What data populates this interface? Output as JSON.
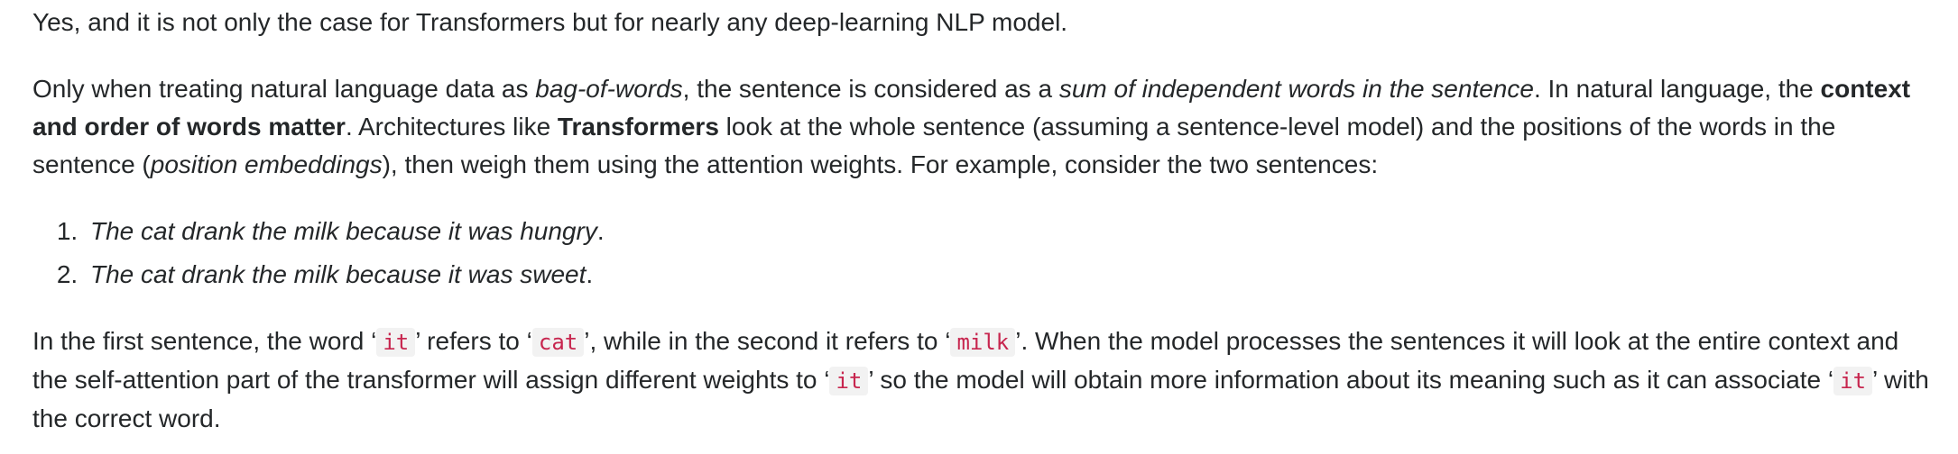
{
  "p1": {
    "text": "Yes, and it is not only the case for Transformers but for nearly any deep-learning NLP model."
  },
  "p2": {
    "t1": "Only when treating natural language data as ",
    "em1": "bag-of-words",
    "t2": ", the sentence is considered as a ",
    "em2": "sum of independent words in the sentence",
    "t3": ". In natural language, the ",
    "strong1": "context and order of words matter",
    "t4": ". Architectures like ",
    "strong2": "Transformers",
    "t5": " look at the whole sentence (assuming a sentence-level model) and the positions of the words in the sentence (",
    "em3": "position embeddings",
    "t6": "), then weigh them using the attention weights. For example, consider the two sentences:"
  },
  "list": {
    "items": [
      {
        "em": "The cat drank the milk because it was hungry",
        "tail": "."
      },
      {
        "em": "The cat drank the milk because it was sweet",
        "tail": "."
      }
    ]
  },
  "p3": {
    "t1": "In the first sentence, the word ‘",
    "c1": "it",
    "t2": "’ refers to ‘",
    "c2": "cat",
    "t3": "’, while in the second it refers to ‘",
    "c3": "milk",
    "t4": "’. When the model processes the sentences it will look at the entire context and the self-attention part of the transformer will assign different weights to ‘",
    "c4": "it",
    "t5": "’ so the model will obtain more information about its meaning such as it can associate ‘",
    "c5": "it",
    "t6": "’ with the correct word."
  }
}
